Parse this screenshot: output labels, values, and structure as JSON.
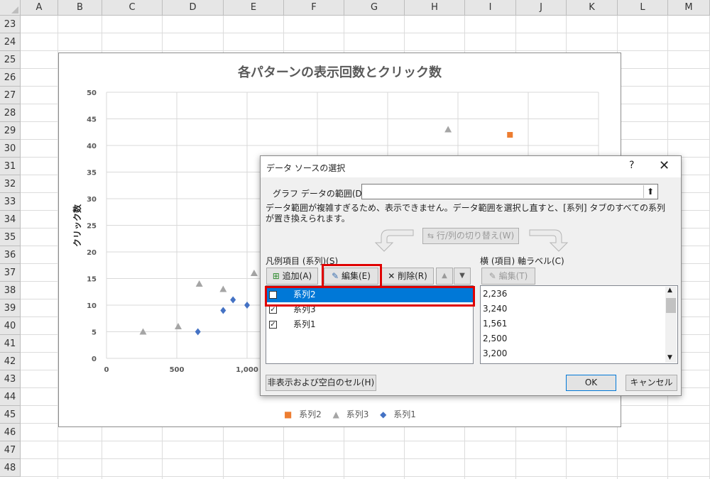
{
  "columns": [
    "A",
    "B",
    "C",
    "D",
    "E",
    "F",
    "G",
    "H",
    "I",
    "J",
    "K",
    "L",
    "M"
  ],
  "rows": [
    "23",
    "24",
    "25",
    "26",
    "27",
    "28",
    "29",
    "30",
    "31",
    "32",
    "33",
    "34",
    "35",
    "36",
    "37",
    "38",
    "39",
    "40",
    "41",
    "42",
    "43",
    "44",
    "45",
    "46",
    "47",
    "48"
  ],
  "chart_data": {
    "type": "scatter",
    "title": "各パターンの表示回数とクリック数",
    "ylabel": "クリック数",
    "xlabel": "",
    "xlim": [
      0,
      3500
    ],
    "ylim": [
      0,
      50
    ],
    "x_ticks": [
      "0",
      "500",
      "1,000"
    ],
    "y_ticks": [
      "0",
      "5",
      "10",
      "15",
      "20",
      "25",
      "30",
      "35",
      "40",
      "45",
      "50"
    ],
    "grid": true,
    "legend_position": "bottom",
    "series": [
      {
        "name": "系列2",
        "marker": "square",
        "color": "#ed7d31",
        "points": [
          [
            2870,
            42
          ]
        ]
      },
      {
        "name": "系列3",
        "marker": "triangle",
        "color": "#a5a5a5",
        "points": [
          [
            260,
            5
          ],
          [
            510,
            6
          ],
          [
            660,
            14
          ],
          [
            830,
            13
          ],
          [
            1050,
            16
          ],
          [
            2430,
            43
          ]
        ]
      },
      {
        "name": "系列1",
        "marker": "diamond",
        "color": "#4472c4",
        "points": [
          [
            650,
            5
          ],
          [
            830,
            9
          ],
          [
            900,
            11
          ],
          [
            1000,
            10
          ]
        ]
      }
    ]
  },
  "legend": [
    "系列2",
    "系列3",
    "系列1"
  ],
  "dialog": {
    "title": "データ ソースの選択",
    "help": "?",
    "close": "✕",
    "range_label": "グラフ データの範囲(D):",
    "range_value": "",
    "range_btn": "⬆",
    "message": "データ範囲が複雑すぎるため、表示できません。データ範囲を選択し直すと、[系列] タブのすべての系列が置き換えられます。",
    "switch_btn": "行/列の切り替え(W)",
    "legend_header": "凡例項目 (系列)(S)",
    "axis_header": "横 (項目) 軸ラベル(C)",
    "add_btn": "追加(A)",
    "edit_btn": "編集(E)",
    "delete_btn": "削除(R)",
    "axis_edit_btn": "編集(T)",
    "series": [
      {
        "label": "系列2",
        "checked": "☑",
        "selected": true
      },
      {
        "label": "系列3",
        "checked": "☑",
        "selected": false
      },
      {
        "label": "系列1",
        "checked": "☑",
        "selected": false
      }
    ],
    "axis_labels": [
      "2,236",
      "3,240",
      "1,561",
      "2,500",
      "3,200"
    ],
    "hidden_cells_btn": "非表示および空白のセル(H)",
    "ok_btn": "OK",
    "cancel_btn": "キャンセル"
  }
}
